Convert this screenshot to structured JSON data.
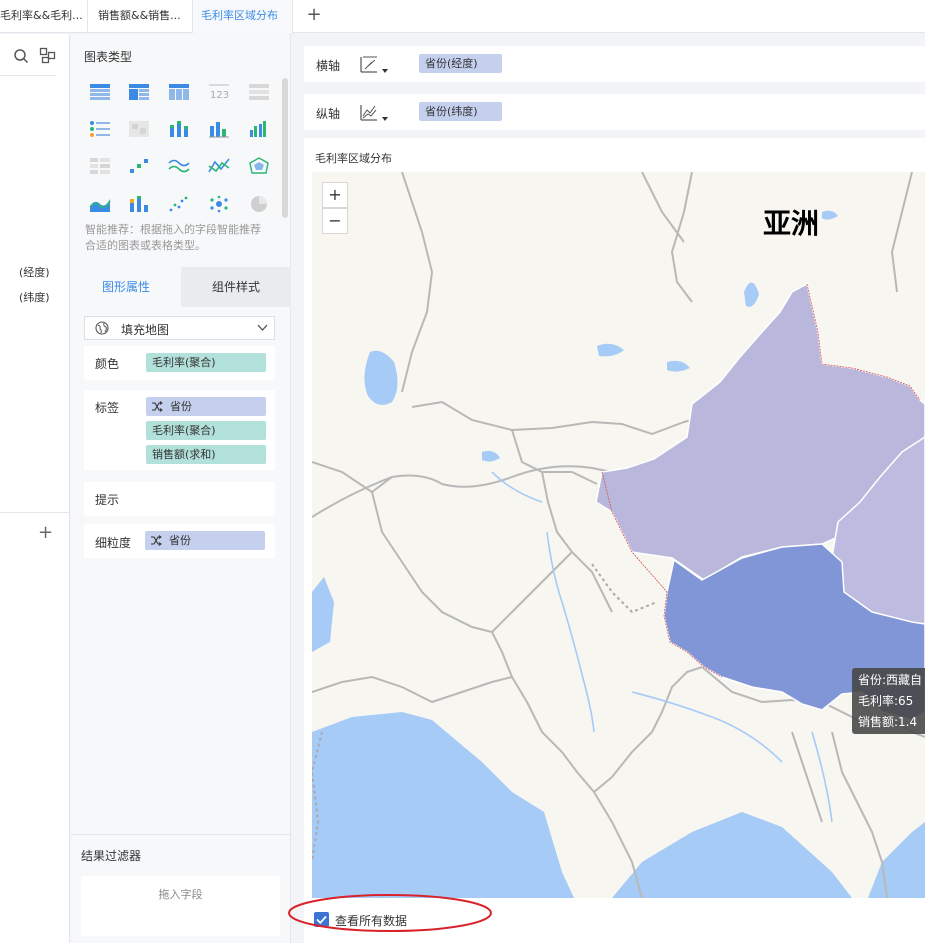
{
  "tabs": [
    {
      "label": "毛利率&&毛利..."
    },
    {
      "label": "销售额&&销售..."
    },
    {
      "label": "毛利率区域分布"
    }
  ],
  "left": {
    "field_longitude": "(经度)",
    "field_latitude": "(纬度)"
  },
  "panel": {
    "chart_type_title": "图表类型",
    "hint": "智能推荐：根据拖入的字段智能推荐合适的图表或表格类型。",
    "subtabs": [
      "图形属性",
      "组件样式"
    ],
    "map_type": "填充地图",
    "color_label": "颜色",
    "color_field": "毛利率(聚合)",
    "label_label": "标签",
    "label_fields": [
      "省份",
      "毛利率(聚合)",
      "销售额(求和)"
    ],
    "tooltip_label": "提示",
    "granularity_label": "细粒度",
    "granularity_field": "省份",
    "filter_title": "结果过滤器",
    "filter_drop": "拖入字段"
  },
  "main": {
    "x_axis_label": "横轴",
    "x_axis_field": "省份(经度)",
    "y_axis_label": "纵轴",
    "y_axis_field": "省份(纬度)",
    "chart_title": "毛利率区域分布",
    "zoom_in": "+",
    "zoom_out": "−",
    "continent": "亚洲",
    "tooltip": {
      "province": "省份:西藏自",
      "margin": "毛利率:65",
      "sales": "销售额:1.4"
    },
    "show_all": "查看所有数据"
  },
  "colors": {
    "accent": "#3b8be5",
    "xinjiang": "#b9b8dc",
    "tibet": "#8196d6",
    "water": "#a6cbf7",
    "land": "#f8f6f0"
  }
}
